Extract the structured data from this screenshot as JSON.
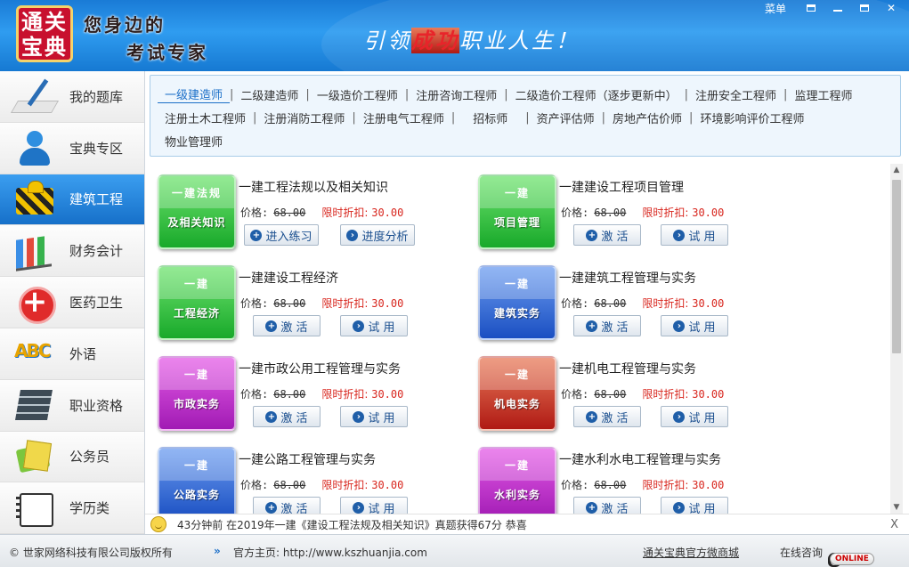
{
  "header": {
    "logo_text": [
      "通关",
      "宝典"
    ],
    "slogan_line1": "您身边的",
    "slogan_line2": "考试专家",
    "tagline_part1": "引领",
    "tagline_red": "成功",
    "tagline_part2": "职业人生！",
    "menu_label": "菜单"
  },
  "sidebar": {
    "items": [
      {
        "label": "我的题库",
        "icon": "pen-notebook-icon",
        "active": false
      },
      {
        "label": "宝典专区",
        "icon": "user-icon",
        "active": false
      },
      {
        "label": "建筑工程",
        "icon": "construction-icon",
        "active": true
      },
      {
        "label": "财务会计",
        "icon": "bar-chart-icon",
        "active": false
      },
      {
        "label": "医药卫生",
        "icon": "medical-cross-icon",
        "active": false
      },
      {
        "label": "外语",
        "icon": "abc-icon",
        "active": false
      },
      {
        "label": "职业资格",
        "icon": "books-icon",
        "active": false
      },
      {
        "label": "公务员",
        "icon": "calculator-icon",
        "active": false
      },
      {
        "label": "学历类",
        "icon": "notebook-icon",
        "active": false
      }
    ]
  },
  "categories": {
    "row1": [
      "一级建造师",
      "二级建造师",
      "一级造价工程师",
      "注册咨询工程师",
      "二级造价工程师（逐步更新中）",
      "注册安全工程师",
      "监理工程师"
    ],
    "row2": [
      "注册土木工程师",
      "注册消防工程师",
      "注册电气工程师",
      "招标师",
      "资产评估师",
      "房地产估价师",
      "环境影响评价工程师"
    ],
    "row3": [
      "物业管理师"
    ],
    "active": "一级建造师"
  },
  "products": [
    {
      "title": "一建工程法规以及相关知识",
      "cover_top": "一建法规",
      "cover_bottom": "及相关知识",
      "price_label": "价格:",
      "price": "68.00",
      "discount_label": "限时折扣:",
      "discount": "30.00",
      "btn1": "进入练习",
      "btn2": "进度分析",
      "color": "green"
    },
    {
      "title": "一建建设工程项目管理",
      "cover_top": "一建",
      "cover_bottom": "项目管理",
      "price_label": "价格:",
      "price": "68.00",
      "discount_label": "限时折扣:",
      "discount": "30.00",
      "btn1": "激 活",
      "btn2": "试 用",
      "color": "green"
    },
    {
      "title": "一建建设工程经济",
      "cover_top": "一建",
      "cover_bottom": "工程经济",
      "price_label": "价格:",
      "price": "68.00",
      "discount_label": "限时折扣:",
      "discount": "30.00",
      "btn1": "激 活",
      "btn2": "试 用",
      "color": "green"
    },
    {
      "title": "一建建筑工程管理与实务",
      "cover_top": "一建",
      "cover_bottom": "建筑实务",
      "price_label": "价格:",
      "price": "68.00",
      "discount_label": "限时折扣:",
      "discount": "30.00",
      "btn1": "激 活",
      "btn2": "试 用",
      "color": "blue"
    },
    {
      "title": "一建市政公用工程管理与实务",
      "cover_top": "一建",
      "cover_bottom": "市政实务",
      "price_label": "价格:",
      "price": "68.00",
      "discount_label": "限时折扣:",
      "discount": "30.00",
      "btn1": "激 活",
      "btn2": "试 用",
      "color": "purple"
    },
    {
      "title": "一建机电工程管理与实务",
      "cover_top": "一建",
      "cover_bottom": "机电实务",
      "price_label": "价格:",
      "price": "68.00",
      "discount_label": "限时折扣:",
      "discount": "30.00",
      "btn1": "激 活",
      "btn2": "试 用",
      "color": "red"
    },
    {
      "title": "一建公路工程管理与实务",
      "cover_top": "一建",
      "cover_bottom": "公路实务",
      "price_label": "价格:",
      "price": "68.00",
      "discount_label": "限时折扣:",
      "discount": "30.00",
      "btn1": "激 活",
      "btn2": "试 用",
      "color": "blue"
    },
    {
      "title": "一建水利水电工程管理与实务",
      "cover_top": "一建",
      "cover_bottom": "水利实务",
      "price_label": "价格:",
      "price": "68.00",
      "discount_label": "限时折扣:",
      "discount": "30.00",
      "btn1": "激 活",
      "btn2": "试 用",
      "color": "purple"
    }
  ],
  "notice": {
    "text": "43分钟前 在2019年一建《建设工程法规及相关知识》真题获得67分 恭喜",
    "close": "X"
  },
  "footer": {
    "copyright": "© 世家网络科技有限公司版权所有",
    "site_label": "官方主页: http://www.kszhuanjia.com",
    "shop_link": "通关宝典官方微商城",
    "consult_label": "在线咨询",
    "online_badge": "ONLINE"
  }
}
